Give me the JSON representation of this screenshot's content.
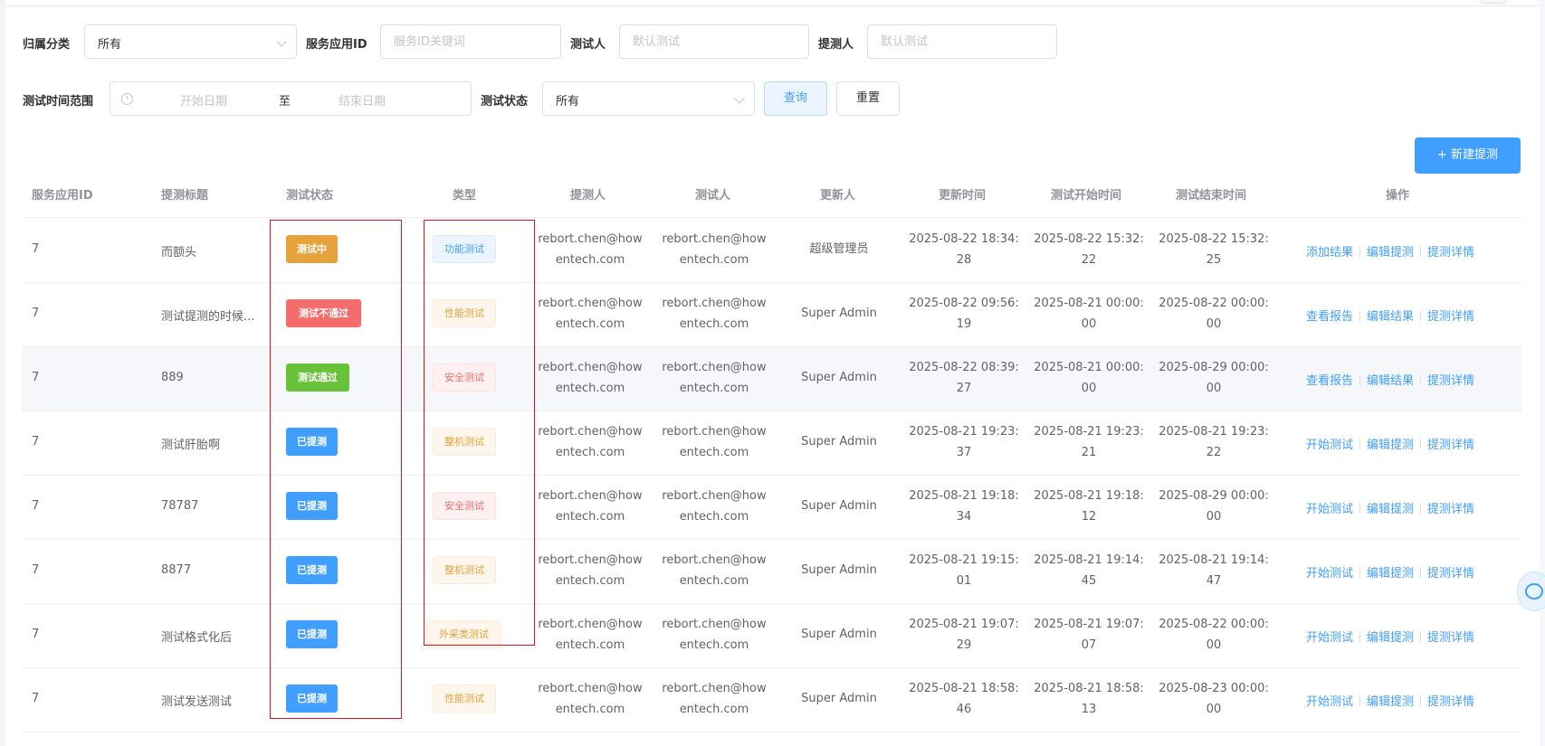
{
  "filters": {
    "category": {
      "label": "归属分类",
      "value": "所有"
    },
    "service_id": {
      "label": "服务应用ID",
      "placeholder": "服务ID关键词"
    },
    "tester": {
      "label": "测试人",
      "placeholder": "默认测试"
    },
    "submitter": {
      "label": "提测人",
      "placeholder": "默认测试"
    },
    "time_range": {
      "label": "测试时间范围",
      "start_placeholder": "开始日期",
      "separator": "至",
      "end_placeholder": "结束日期"
    },
    "status": {
      "label": "测试状态",
      "value": "所有"
    },
    "query_label": "查询",
    "reset_label": "重置"
  },
  "new_button_label": "+ 新建提测",
  "table": {
    "headers": [
      "服务应用ID",
      "提测标题",
      "测试状态",
      "类型",
      "提测人",
      "测试人",
      "更新人",
      "更新时间",
      "测试开始时间",
      "测试结束时间",
      "操作"
    ],
    "rows": [
      {
        "id": "7",
        "title": "而额头",
        "status": "测试中",
        "type": "功能测试",
        "submitter": [
          "rebort.chen@how",
          "entech.com"
        ],
        "tester": [
          "rebort.chen@how",
          "entech.com"
        ],
        "updater": "超级管理员",
        "updated": [
          "2025-08-22 18:34:",
          "28"
        ],
        "start": [
          "2025-08-22 15:32:",
          "22"
        ],
        "end": [
          "2025-08-22 15:32:",
          "25"
        ],
        "ops": [
          "添加结果",
          "编辑提测",
          "提测详情"
        ]
      },
      {
        "id": "7",
        "title": "测试提测的时候...",
        "status": "测试不通过",
        "type": "性能测试",
        "submitter": [
          "rebort.chen@how",
          "entech.com"
        ],
        "tester": [
          "rebort.chen@how",
          "entech.com"
        ],
        "updater": "Super Admin",
        "updated": [
          "2025-08-22 09:56:",
          "19"
        ],
        "start": [
          "2025-08-21 00:00:",
          "00"
        ],
        "end": [
          "2025-08-22 00:00:",
          "00"
        ],
        "ops": [
          "查看报告",
          "编辑结果",
          "提测详情"
        ]
      },
      {
        "id": "7",
        "title": "889",
        "status": "测试通过",
        "type": "安全测试",
        "submitter": [
          "rebort.chen@how",
          "entech.com"
        ],
        "tester": [
          "rebort.chen@how",
          "entech.com"
        ],
        "updater": "Super Admin",
        "updated": [
          "2025-08-22 08:39:",
          "27"
        ],
        "start": [
          "2025-08-21 00:00:",
          "00"
        ],
        "end": [
          "2025-08-29 00:00:",
          "00"
        ],
        "ops": [
          "查看报告",
          "编辑结果",
          "提测详情"
        ]
      },
      {
        "id": "7",
        "title": "测试肝胎啊",
        "status": "已提测",
        "type": "整机测试",
        "submitter": [
          "rebort.chen@how",
          "entech.com"
        ],
        "tester": [
          "rebort.chen@how",
          "entech.com"
        ],
        "updater": "Super Admin",
        "updated": [
          "2025-08-21 19:23:",
          "37"
        ],
        "start": [
          "2025-08-21 19:23:",
          "21"
        ],
        "end": [
          "2025-08-21 19:23:",
          "22"
        ],
        "ops": [
          "开始测试",
          "编辑提测",
          "提测详情"
        ]
      },
      {
        "id": "7",
        "title": "78787",
        "status": "已提测",
        "type": "安全测试",
        "submitter": [
          "rebort.chen@how",
          "entech.com"
        ],
        "tester": [
          "rebort.chen@how",
          "entech.com"
        ],
        "updater": "Super Admin",
        "updated": [
          "2025-08-21 19:18:",
          "34"
        ],
        "start": [
          "2025-08-21 19:18:",
          "12"
        ],
        "end": [
          "2025-08-29 00:00:",
          "00"
        ],
        "ops": [
          "开始测试",
          "编辑提测",
          "提测详情"
        ]
      },
      {
        "id": "7",
        "title": "8877",
        "status": "已提测",
        "type": "整机测试",
        "submitter": [
          "rebort.chen@how",
          "entech.com"
        ],
        "tester": [
          "rebort.chen@how",
          "entech.com"
        ],
        "updater": "Super Admin",
        "updated": [
          "2025-08-21 19:15:",
          "01"
        ],
        "start": [
          "2025-08-21 19:14:",
          "45"
        ],
        "end": [
          "2025-08-21 19:14:",
          "47"
        ],
        "ops": [
          "开始测试",
          "编辑提测",
          "提测详情"
        ]
      },
      {
        "id": "7",
        "title": "测试格式化后",
        "status": "已提测",
        "type": "外采类测试",
        "submitter": [
          "rebort.chen@how",
          "entech.com"
        ],
        "tester": [
          "rebort.chen@how",
          "entech.com"
        ],
        "updater": "Super Admin",
        "updated": [
          "2025-08-21 19:07:",
          "29"
        ],
        "start": [
          "2025-08-21 19:07:",
          "07"
        ],
        "end": [
          "2025-08-22 00:00:",
          "00"
        ],
        "ops": [
          "开始测试",
          "编辑提测",
          "提测详情"
        ]
      },
      {
        "id": "7",
        "title": "测试发送测试",
        "status": "已提测",
        "type": "性能测试",
        "submitter": [
          "rebort.chen@how",
          "entech.com"
        ],
        "tester": [
          "rebort.chen@how",
          "entech.com"
        ],
        "updater": "Super Admin",
        "updated": [
          "2025-08-21 18:58:",
          "46"
        ],
        "start": [
          "2025-08-21 18:58:",
          "13"
        ],
        "end": [
          "2025-08-23 00:00:",
          "00"
        ],
        "ops": [
          "开始测试",
          "编辑提测",
          "提测详情"
        ]
      }
    ]
  },
  "colors": {
    "status_testing": "#e6a23c",
    "status_failed": "#f56c6c",
    "status_passed": "#67c23a",
    "status_submitted": "#409eff",
    "annotation_red": "#e0141e",
    "link_blue": "#409eff"
  }
}
